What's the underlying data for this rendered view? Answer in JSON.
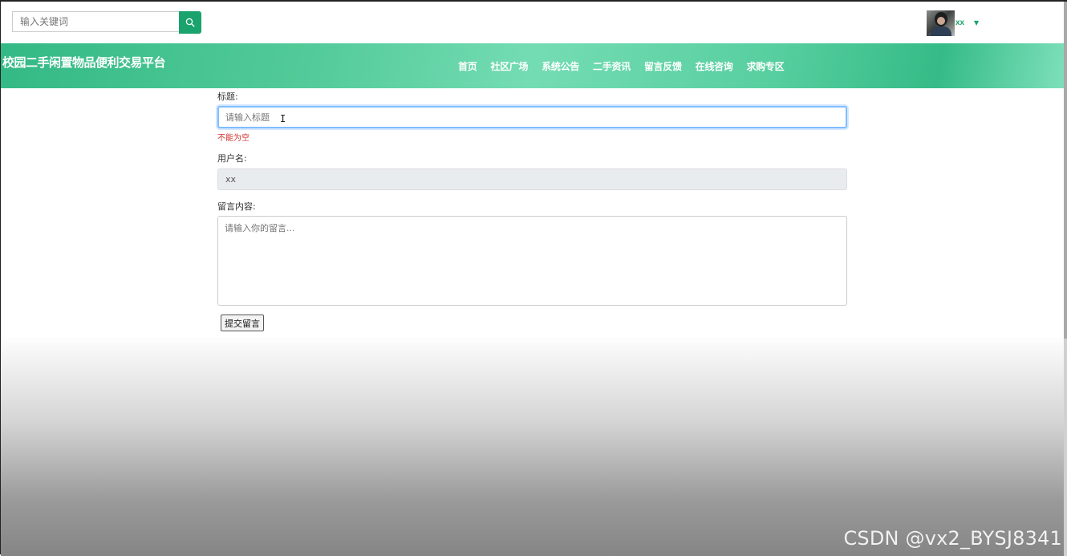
{
  "search": {
    "placeholder": "输入关键词"
  },
  "user": {
    "name": "xx"
  },
  "site": {
    "title": "校园二手闲置物品便利交易平台"
  },
  "nav": [
    "首页",
    "社区广场",
    "系统公告",
    "二手资讯",
    "留言反馈",
    "在线咨询",
    "求购专区"
  ],
  "form": {
    "title_label": "标题:",
    "title_placeholder": "请输入标题",
    "title_error": "不能为空",
    "username_label": "用户名:",
    "username_value": "xx",
    "content_label": "留言内容:",
    "content_placeholder": "请输入你的留言...",
    "submit_label": "提交留言"
  },
  "watermark": "CSDN @vx2_BYSJ8341",
  "colors": {
    "accent": "#1aa36c",
    "banner": "#54cb9a",
    "error": "#d0322e",
    "focus": "#80bdff"
  }
}
